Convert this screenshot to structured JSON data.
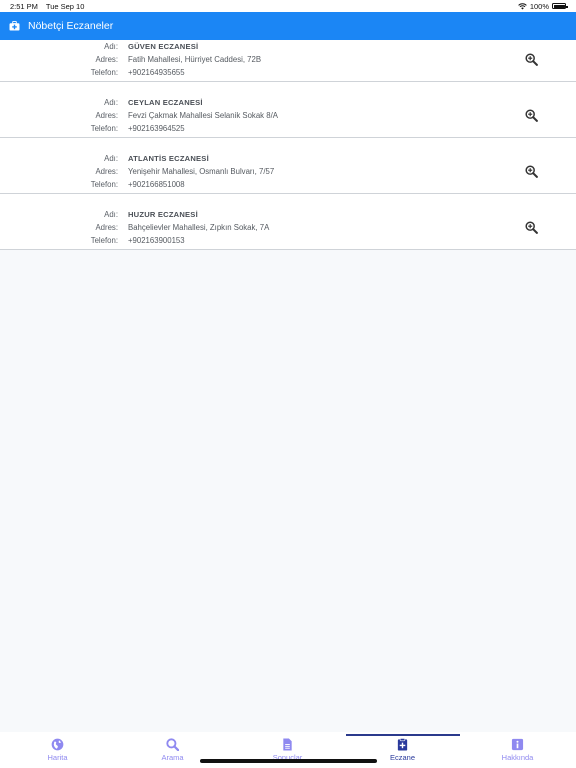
{
  "status": {
    "time": "2:51 PM",
    "date": "Tue Sep 10",
    "battery": "100%"
  },
  "header": {
    "title": "Nöbetçi Eczaneler"
  },
  "labels": {
    "name": "Adı:",
    "address": "Adres:",
    "phone": "Telefon:"
  },
  "pharmacies": [
    {
      "name": "GÜVEN ECZANESİ",
      "address": "Fatih Mahallesi, Hürriyet Caddesi, 72B",
      "phone": "+902164935655"
    },
    {
      "name": "CEYLAN ECZANESİ",
      "address": "Fevzi Çakmak Mahallesi Selanik Sokak 8/A",
      "phone": "+902163964525"
    },
    {
      "name": "ATLANTİS ECZANESİ",
      "address": "Yenişehir Mahallesi, Osmanlı Bulvarı, 7/57",
      "phone": "+902166851008"
    },
    {
      "name": "HUZUR ECZANESİ",
      "address": "Bahçelievler Mahallesi, Zıpkın Sokak, 7A",
      "phone": "+902163900153"
    }
  ],
  "tabs": [
    {
      "label": "Harita",
      "icon": "globe-icon"
    },
    {
      "label": "Arama",
      "icon": "search-icon"
    },
    {
      "label": "Sonuçlar",
      "icon": "document-icon"
    },
    {
      "label": "Eczane",
      "icon": "clipboard-plus-icon",
      "active": true
    },
    {
      "label": "Hakkında",
      "icon": "info-icon"
    }
  ],
  "colors": {
    "navbar": "#1b86f5",
    "tab_inactive": "#8f89f0",
    "tab_active": "#2a3a9c"
  }
}
